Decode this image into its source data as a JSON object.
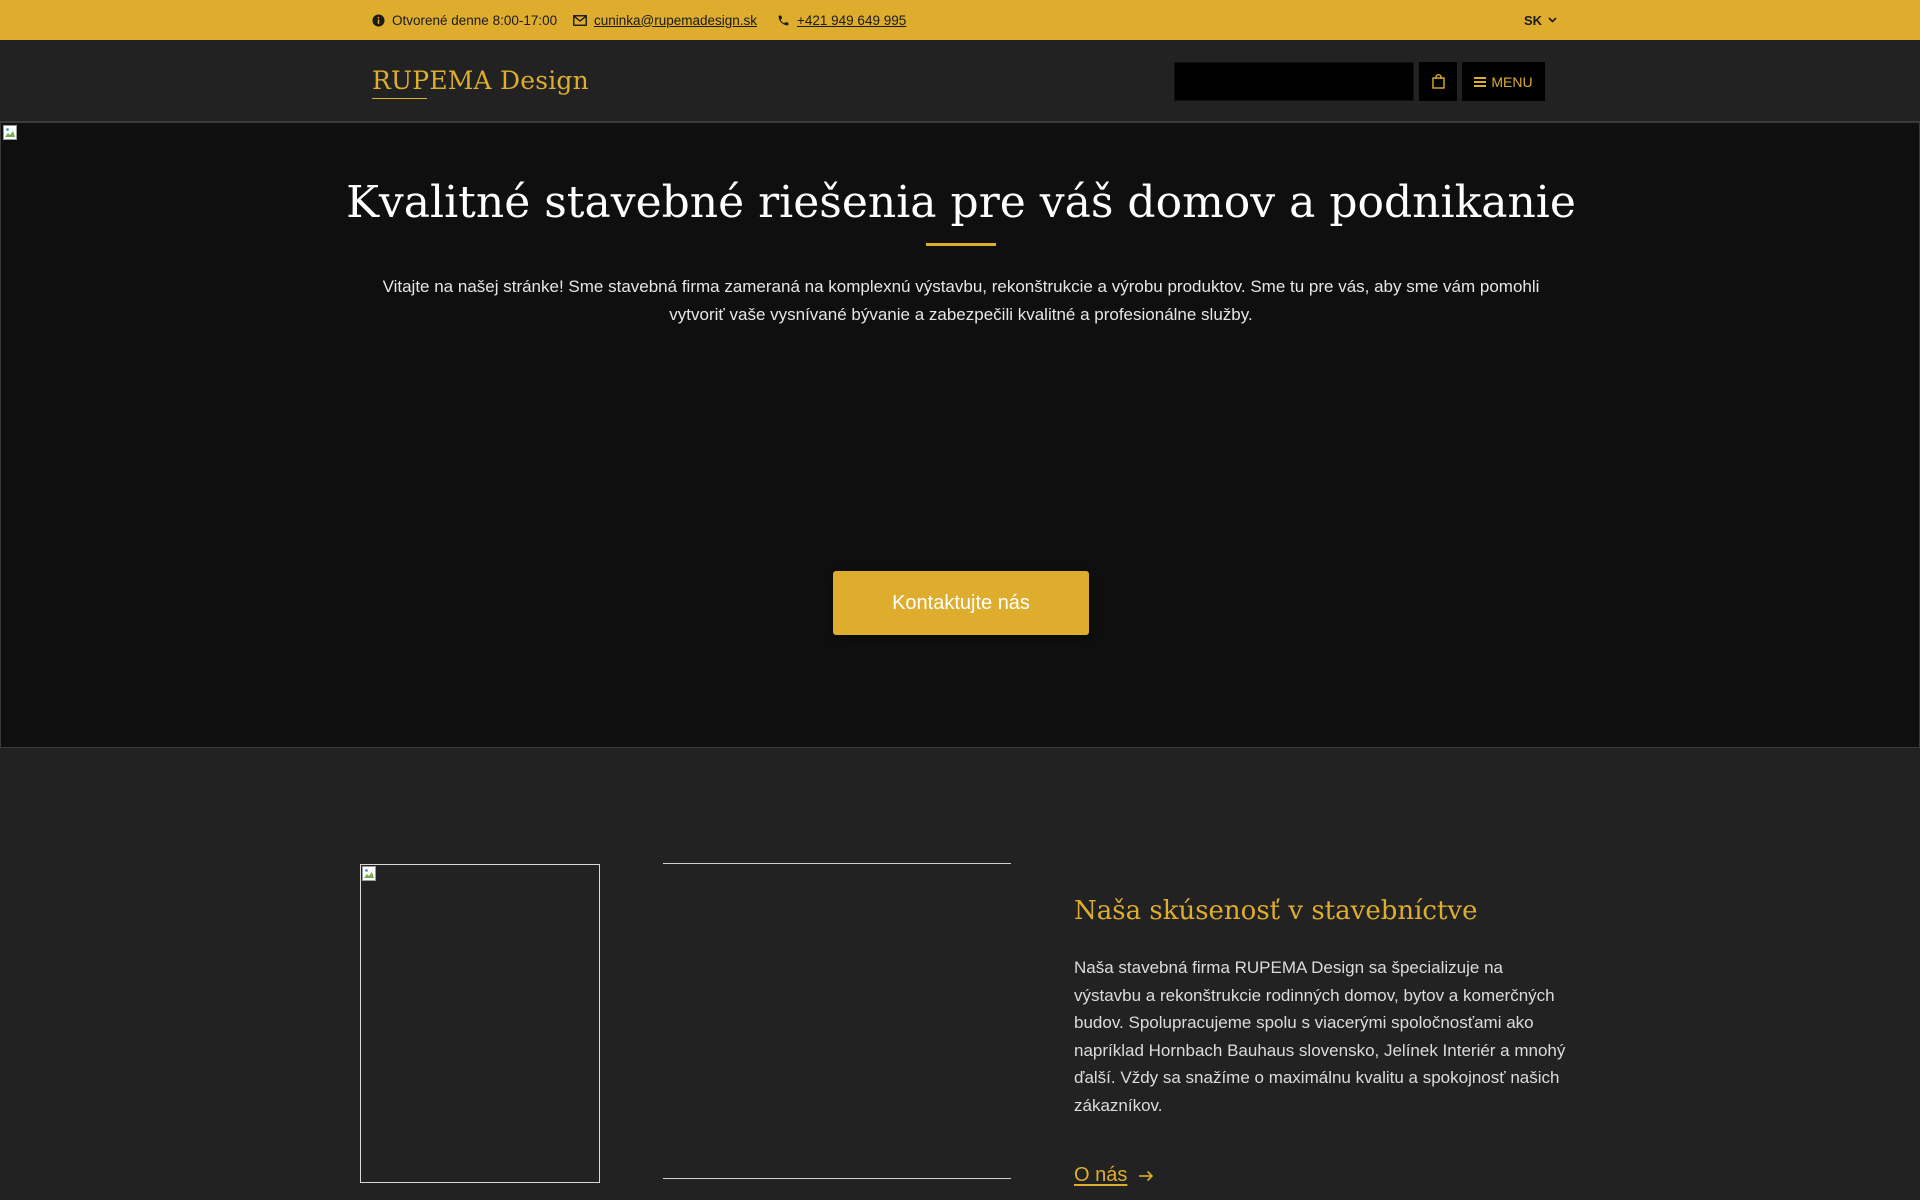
{
  "topbar": {
    "hours": "Otvorené denne 8:00-17:00",
    "email": "cuninka@rupemadesign.sk",
    "phone": "+421 949 649 995",
    "language": "SK"
  },
  "header": {
    "logo": "RUPEMA Design",
    "search_placeholder": "",
    "menu_label": "MENU"
  },
  "hero": {
    "title": "Kvalitné stavebné riešenia pre váš domov a podnikanie",
    "text": "Vitajte na našej stránke! Sme stavebná firma zameraná na komplexnú výstavbu, rekonštrukcie a výrobu produktov. Sme tu pre vás, aby sme vám pomohli vytvoriť vaše vysnívané bývanie a zabezpečili kvalitné a profesionálne služby.",
    "cta": "Kontaktujte nás"
  },
  "about": {
    "title": "Naša skúsenosť v stavebníctve",
    "text": "Naša stavebná firma RUPEMA Design sa špecializuje na výstavbu a rekonštrukcie rodinných domov, bytov a komerčných budov. Spolupracujeme spolu s viacerými spoločnosťami ako napríklad Hornbach Bauhaus slovensko, Jelínek Interiér a mnohý ďalší. Vždy sa snažíme o maximálnu kvalitu a spokojnosť našich zákazníkov.",
    "link": "O nás"
  },
  "colors": {
    "accent": "#dead2e",
    "page_bg": "#222222",
    "hero_bg": "#0f0f0f"
  },
  "icons": [
    "info-icon",
    "mail-icon",
    "phone-icon",
    "chevron-down-icon",
    "shopping-bag-icon",
    "hamburger-icon",
    "arrow-right-icon",
    "broken-image-icon"
  ]
}
